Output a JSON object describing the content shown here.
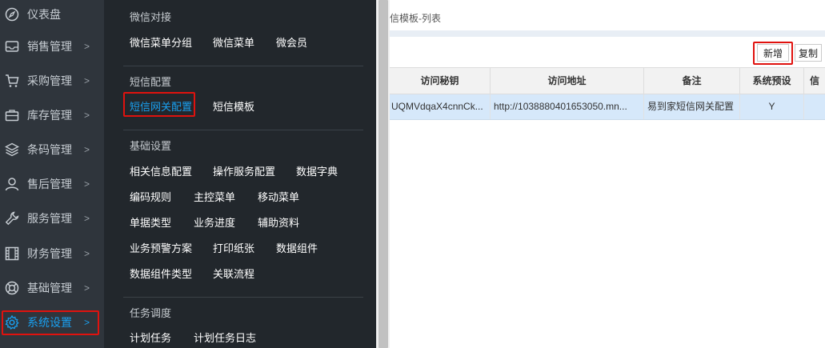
{
  "sidebar": {
    "items": [
      {
        "label": "仪表盘",
        "icon": "compass-icon"
      },
      {
        "label": "销售管理",
        "icon": "inbox-icon"
      },
      {
        "label": "采购管理",
        "icon": "cart-icon"
      },
      {
        "label": "库存管理",
        "icon": "briefcase-icon"
      },
      {
        "label": "条码管理",
        "icon": "layers-icon"
      },
      {
        "label": "售后管理",
        "icon": "user-icon"
      },
      {
        "label": "服务管理",
        "icon": "wrench-icon"
      },
      {
        "label": "财务管理",
        "icon": "film-icon"
      },
      {
        "label": "基础管理",
        "icon": "lifebuoy-icon"
      },
      {
        "label": "系统设置",
        "icon": "gear-icon"
      }
    ],
    "chevron": ">"
  },
  "menu": {
    "wechat": {
      "title": "微信对接",
      "links": [
        "微信菜单分组",
        "微信菜单",
        "微会员"
      ]
    },
    "sms": {
      "title": "短信配置",
      "links": [
        "短信网关配置",
        "短信模板"
      ]
    },
    "base": {
      "title": "基础设置",
      "rows": [
        [
          "相关信息配置",
          "操作服务配置",
          "数据字典"
        ],
        [
          "编码规则",
          "主控菜单",
          "移动菜单"
        ],
        [
          "单据类型",
          "业务进度",
          "辅助资料"
        ],
        [
          "业务预警方案",
          "打印纸张",
          "数据组件"
        ],
        [
          "数据组件类型",
          "关联流程"
        ]
      ]
    },
    "task": {
      "title": "任务调度",
      "links": [
        "计划任务",
        "计划任务日志"
      ]
    }
  },
  "content": {
    "breadcrumb": "信模板-列表",
    "buttons": {
      "add": "新增",
      "copy": "复制"
    },
    "table": {
      "headers": [
        "访问秘钥",
        "访问地址",
        "备注",
        "系统预设",
        "信"
      ],
      "rows": [
        [
          "UQMVdqaX4cnnCk...",
          "http://1038880401653050.mn...",
          "易到家短信网关配置",
          "Y",
          ""
        ]
      ]
    }
  },
  "colors": {
    "accent": "#19a0f0",
    "highlight": "#e0120e",
    "sidebar_bg": "#2f353c",
    "panel_bg": "#22272c",
    "row_selected": "#d6e8fa"
  }
}
